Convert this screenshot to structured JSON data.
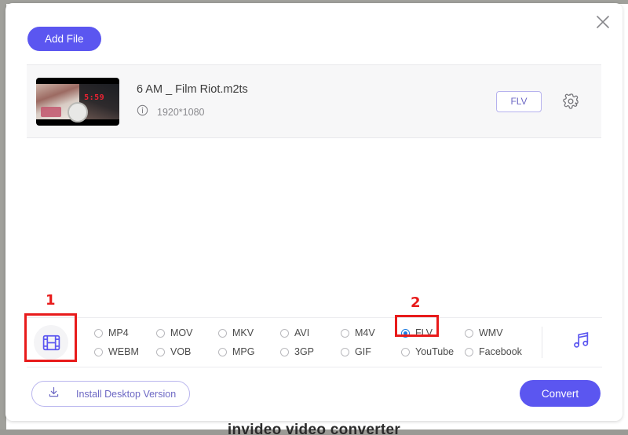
{
  "window": {
    "close_icon": "close-icon"
  },
  "toolbar": {
    "add_file_label": "Add File"
  },
  "file_row": {
    "thumbnail_digits": "5:59",
    "file_name": "6 AM _ Film Riot.m2ts",
    "info_icon": "info-icon",
    "resolution": "1920*1080",
    "output_format_label": "FLV",
    "settings_icon": "gear-icon"
  },
  "format_bar": {
    "video_icon": "film-strip-icon",
    "audio_icon": "music-note-icon",
    "options": [
      {
        "label": "MP4",
        "selected": false
      },
      {
        "label": "MOV",
        "selected": false
      },
      {
        "label": "MKV",
        "selected": false
      },
      {
        "label": "AVI",
        "selected": false
      },
      {
        "label": "M4V",
        "selected": false
      },
      {
        "label": "FLV",
        "selected": true
      },
      {
        "label": "WMV",
        "selected": false
      },
      {
        "label": "WEBM",
        "selected": false
      },
      {
        "label": "VOB",
        "selected": false
      },
      {
        "label": "MPG",
        "selected": false
      },
      {
        "label": "3GP",
        "selected": false
      },
      {
        "label": "GIF",
        "selected": false
      },
      {
        "label": "YouTube",
        "selected": false
      },
      {
        "label": "Facebook",
        "selected": false
      }
    ]
  },
  "annotations": [
    {
      "number": "1"
    },
    {
      "number": "2"
    }
  ],
  "bottom_bar": {
    "install_label": "Install Desktop Version",
    "install_icon": "download-icon",
    "convert_label": "Convert"
  },
  "watermark": {
    "text": "invideo video converter"
  },
  "colors": {
    "accent": "#5b56f0",
    "accent_soft": "#6d68c4",
    "annotation_red": "#e81b1b",
    "radio_selected": "#1a7ae0"
  }
}
